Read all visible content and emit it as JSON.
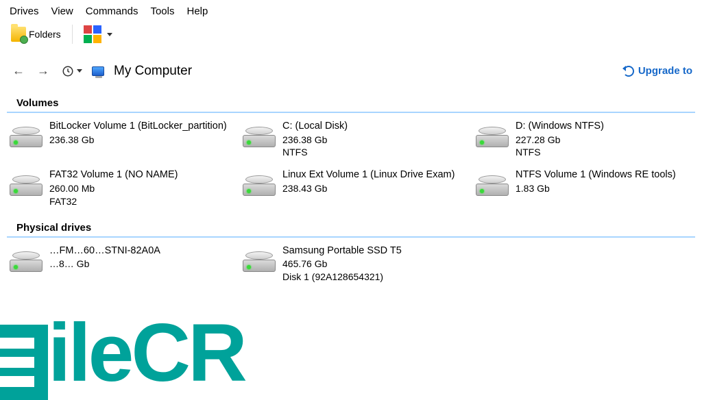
{
  "menubar": [
    "Drives",
    "View",
    "Commands",
    "Tools",
    "Help"
  ],
  "toolbar": {
    "folders_label": "Folders"
  },
  "nav": {
    "location": "My Computer",
    "upgrade_label": "Upgrade to"
  },
  "sections": {
    "volumes": {
      "heading": "Volumes",
      "items": [
        {
          "title": "BitLocker Volume 1 (BitLocker_partition)",
          "size": "236.38 Gb",
          "fs": ""
        },
        {
          "title": "C: (Local Disk)",
          "size": "236.38 Gb",
          "fs": "NTFS"
        },
        {
          "title": "D: (Windows NTFS)",
          "size": "227.28 Gb",
          "fs": "NTFS"
        },
        {
          "title": "FAT32 Volume 1 (NO NAME)",
          "size": "260.00 Mb",
          "fs": "FAT32"
        },
        {
          "title": "Linux Ext Volume 1 (Linux Drive Exam)",
          "size": "238.43 Gb",
          "fs": ""
        },
        {
          "title": "NTFS Volume 1 (Windows RE tools)",
          "size": "1.83 Gb",
          "fs": ""
        }
      ]
    },
    "physical": {
      "heading": "Physical drives",
      "items": [
        {
          "title": "…FM…60…STNI-82A0A",
          "size": "…8… Gb",
          "extra": ""
        },
        {
          "title": "Samsung Portable SSD T5",
          "size": "465.76 Gb",
          "extra": "Disk 1 (92A128654321)"
        }
      ]
    }
  },
  "watermark": "ileCR"
}
